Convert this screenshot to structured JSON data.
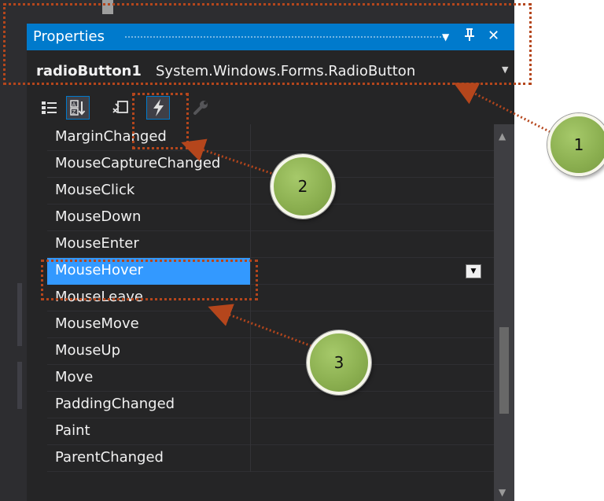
{
  "panel": {
    "title": "Properties",
    "title_buttons": [
      "▼",
      "📌",
      "✕"
    ]
  },
  "selector": {
    "object_name": "radioButton1",
    "object_type": "System.Windows.Forms.RadioButton"
  },
  "toolbar": {
    "buttons": [
      {
        "icon": "categorized-icon",
        "pressed": false
      },
      {
        "icon": "alphabetical-icon",
        "pressed": true
      },
      {
        "icon": "properties-icon",
        "pressed": false
      },
      {
        "icon": "events-lightning-icon",
        "pressed": true
      },
      {
        "icon": "property-pages-wrench-icon",
        "pressed": false
      }
    ]
  },
  "events": [
    {
      "label": "MarginChanged",
      "selected": false
    },
    {
      "label": "MouseCaptureChanged",
      "selected": false
    },
    {
      "label": "MouseClick",
      "selected": false
    },
    {
      "label": "MouseDown",
      "selected": false
    },
    {
      "label": "MouseEnter",
      "selected": false
    },
    {
      "label": "MouseHover",
      "selected": true
    },
    {
      "label": "MouseLeave",
      "selected": false
    },
    {
      "label": "MouseMove",
      "selected": false
    },
    {
      "label": "MouseUp",
      "selected": false
    },
    {
      "label": "Move",
      "selected": false
    },
    {
      "label": "PaddingChanged",
      "selected": false
    },
    {
      "label": "Paint",
      "selected": false
    },
    {
      "label": "ParentChanged",
      "selected": false
    }
  ],
  "callouts": [
    "1",
    "2",
    "3"
  ],
  "colors": {
    "accent": "#007acc",
    "selection": "#3399ff",
    "annotation": "#b5461c",
    "callout_fill": "#8aae4f"
  }
}
